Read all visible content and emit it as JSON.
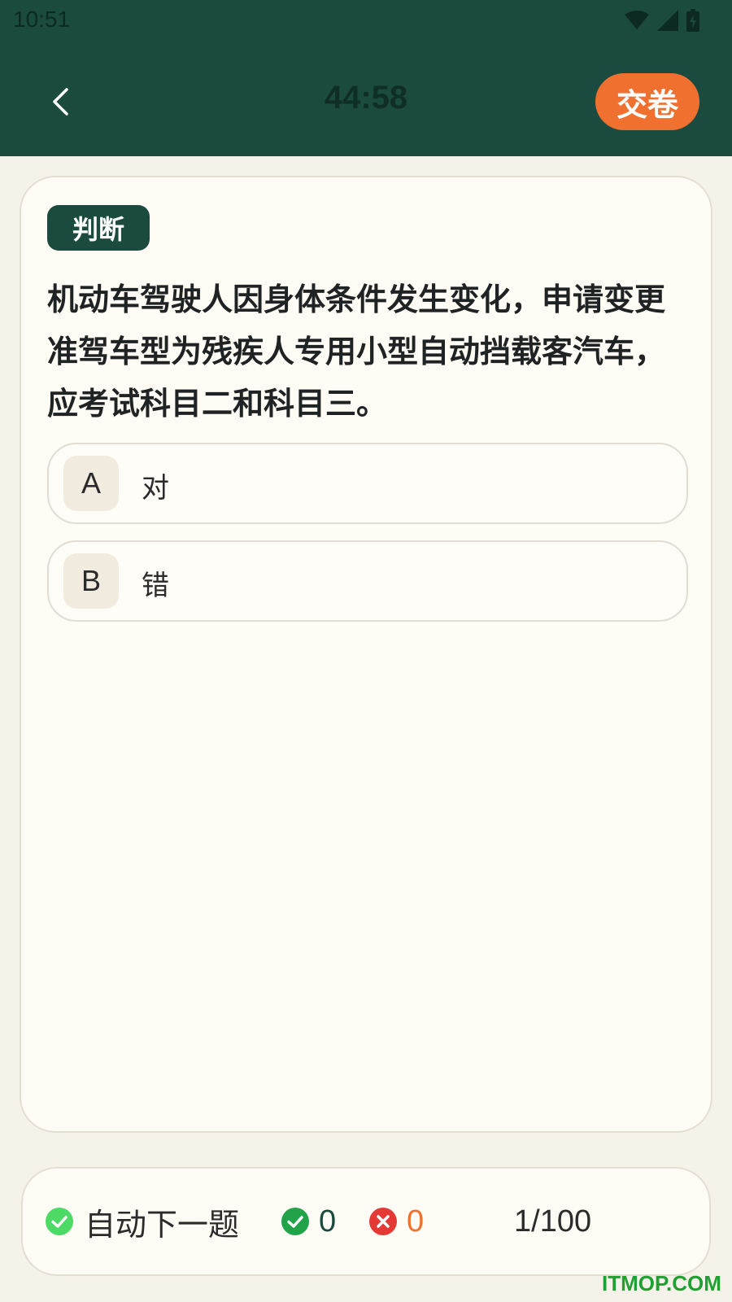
{
  "status_bar": {
    "time": "10:51",
    "icons": [
      "wifi-icon",
      "signal-icon",
      "battery-icon"
    ]
  },
  "header": {
    "back_icon": "chevron-left-icon",
    "timer": "44:58",
    "submit_label": "交卷"
  },
  "question": {
    "type_label": "判断",
    "text": "机动车驾驶人因身体条件发生变化，申请变更准驾车型为残疾人专用小型自动挡载客汽车，应考试科目二和科目三。",
    "options": [
      {
        "letter": "A",
        "text": "对"
      },
      {
        "letter": "B",
        "text": "错"
      }
    ]
  },
  "bottom_bar": {
    "auto_next_label": "自动下一题",
    "auto_next_enabled": true,
    "correct_count": "0",
    "wrong_count": "0",
    "progress": "1/100"
  },
  "watermark": "ITMOP.COM",
  "colors": {
    "header_bg": "#1b4a3e",
    "accent_orange": "#f07030",
    "correct_green": "#22a34a",
    "toggle_green": "#4cd964",
    "wrong_red": "#e53935",
    "page_bg": "#f5f2ea"
  }
}
